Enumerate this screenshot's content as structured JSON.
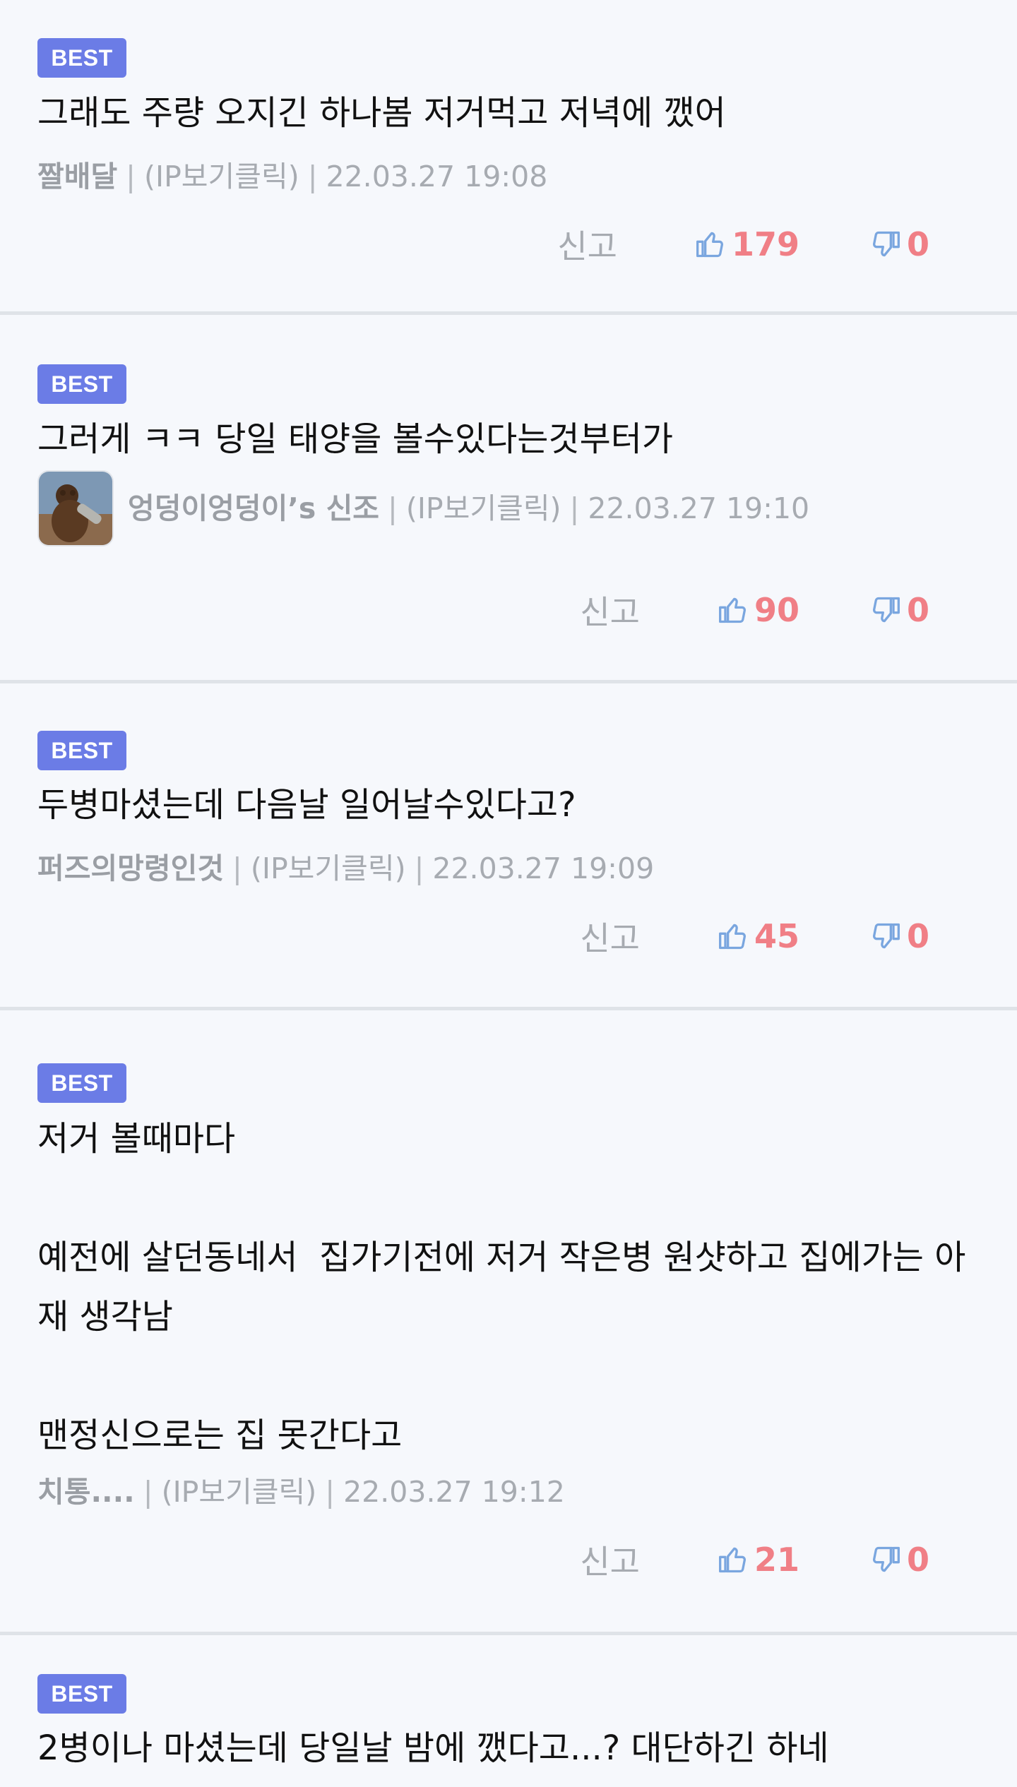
{
  "badge_label": "BEST",
  "report_label": "신고",
  "separator": "|",
  "icons": {
    "like": "thumbs-up-icon",
    "dislike": "thumbs-down-icon"
  },
  "colors": {
    "badge": "#6b7ce6",
    "counts": "#f07f86",
    "thumb_icons": "#7aa6df"
  },
  "comments": [
    {
      "text": "그래도 주량 오지긴 하나봄 저거먹고 저녁에 깼어",
      "nick": "짤배달",
      "ip": "(IP보기클릭)",
      "time": "22.03.27 19:08",
      "likes": "179",
      "dislikes": "0"
    },
    {
      "text": "그러게 ㅋㅋ 당일 태양을 볼수있다는것부터가",
      "nick": "엉덩이엉덩이’s 신조",
      "ip": "(IP보기클릭)",
      "time": "22.03.27 19:10",
      "likes": "90",
      "dislikes": "0"
    },
    {
      "text": "두병마셨는데 다음날 일어날수있다고?",
      "nick": "퍼즈의망령인것",
      "ip": "(IP보기클릭)",
      "time": "22.03.27 19:09",
      "likes": "45",
      "dislikes": "0"
    },
    {
      "text": "저거 볼때마다\n\n예전에 살던동네서  집가기전에 저거 작은병 원샷하고 집에가는 아재 생각남\n\n맨정신으로는 집 못간다고",
      "nick": "치통....",
      "ip": "(IP보기클릭)",
      "time": "22.03.27 19:12",
      "likes": "21",
      "dislikes": "0"
    },
    {
      "text": "2병이나 마셨는데 당일날 밤에 깼다고...? 대단하긴 하네"
    }
  ]
}
